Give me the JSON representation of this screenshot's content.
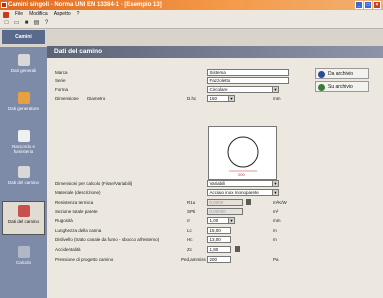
{
  "window": {
    "title": "Camini singoli - Norma UNI EN 13384-1 - [Esempio 13] "
  },
  "menu": [
    "File",
    "Modifica",
    "Aspetto",
    "?"
  ],
  "toolbar_icons": [
    "new-icon",
    "open-icon",
    "save-icon",
    "print-icon",
    "help-icon"
  ],
  "sidebar": {
    "tab": "Camini",
    "items": [
      {
        "label": "Dati generali",
        "icon": "settings-icon",
        "color": "#d8d8d8"
      },
      {
        "label": "Dati generatore",
        "icon": "flame-icon",
        "color": "#e8a040"
      },
      {
        "label": "Raccordo e fumisteria",
        "icon": "connector-icon",
        "color": "#f0f0f0"
      },
      {
        "label": "Dati del camino",
        "icon": "chimney-icon",
        "color": "#c85050"
      },
      {
        "label": "Calcolo",
        "icon": "calculator-icon",
        "color": "#b0b8c8"
      }
    ],
    "section": "Dati del camino"
  },
  "form": {
    "header": "Dati del camino",
    "marca_label": "Marca",
    "marca_value": "Sistema",
    "serie_label": "Serie",
    "serie_value": "Fazzoletto",
    "forma_label": "Forma",
    "forma_value": "Circolare",
    "dimensione_label": "Dimensione",
    "dimensione_sub": "Diametro",
    "dimensione_sym": "D.hc",
    "dimensione_value": "150",
    "dimensione_unit": "mm",
    "preview_dim": "200",
    "dimensioni_calcolo_label": "Dimensioni per calcolo (Fisse/Variabili)",
    "dimensioni_calcolo_value": "Variabili",
    "materiale_label": "Materiale (descrizione)",
    "materiale_value": "Acciaio inox monoparete",
    "resistenza_label": "Resistenza termica",
    "resistenza_sym": "R1u",
    "resistenza_value": "0,0000",
    "resistenza_unit": "m²K/W",
    "sezione_label": "Sezione totale parete",
    "sezione_sym": "SPti",
    "sezione_value": "0,00000",
    "sezione_unit": "m²",
    "rugosita_label": "Rugosità",
    "rugosita_sym": "rr",
    "rugosita_value": "1,00",
    "rugosita_unit": "mm",
    "lunghezza_label": "Lunghezza della canna",
    "lunghezza_sym": "Lc",
    "lunghezza_value": "15,00",
    "lunghezza_unit": "m",
    "dislivello_label": "Dislivello (tratto canale da fumo - sbocco all'esterno)",
    "dislivello_sym": "Hc",
    "dislivello_value": "13,00",
    "dislivello_unit": "m",
    "accidentalita_label": "Accidentalità",
    "accidentalita_sym": "Zc",
    "accidentalita_value": "1,80",
    "pressione_label": "Pressione di progetto camino",
    "pressione_sym": "Ped,ammiss",
    "pressione_value": "200",
    "pressione_unit": "Pa",
    "btn_archivio": "Da archivio",
    "btn_su_archivio": "Su archivio"
  }
}
